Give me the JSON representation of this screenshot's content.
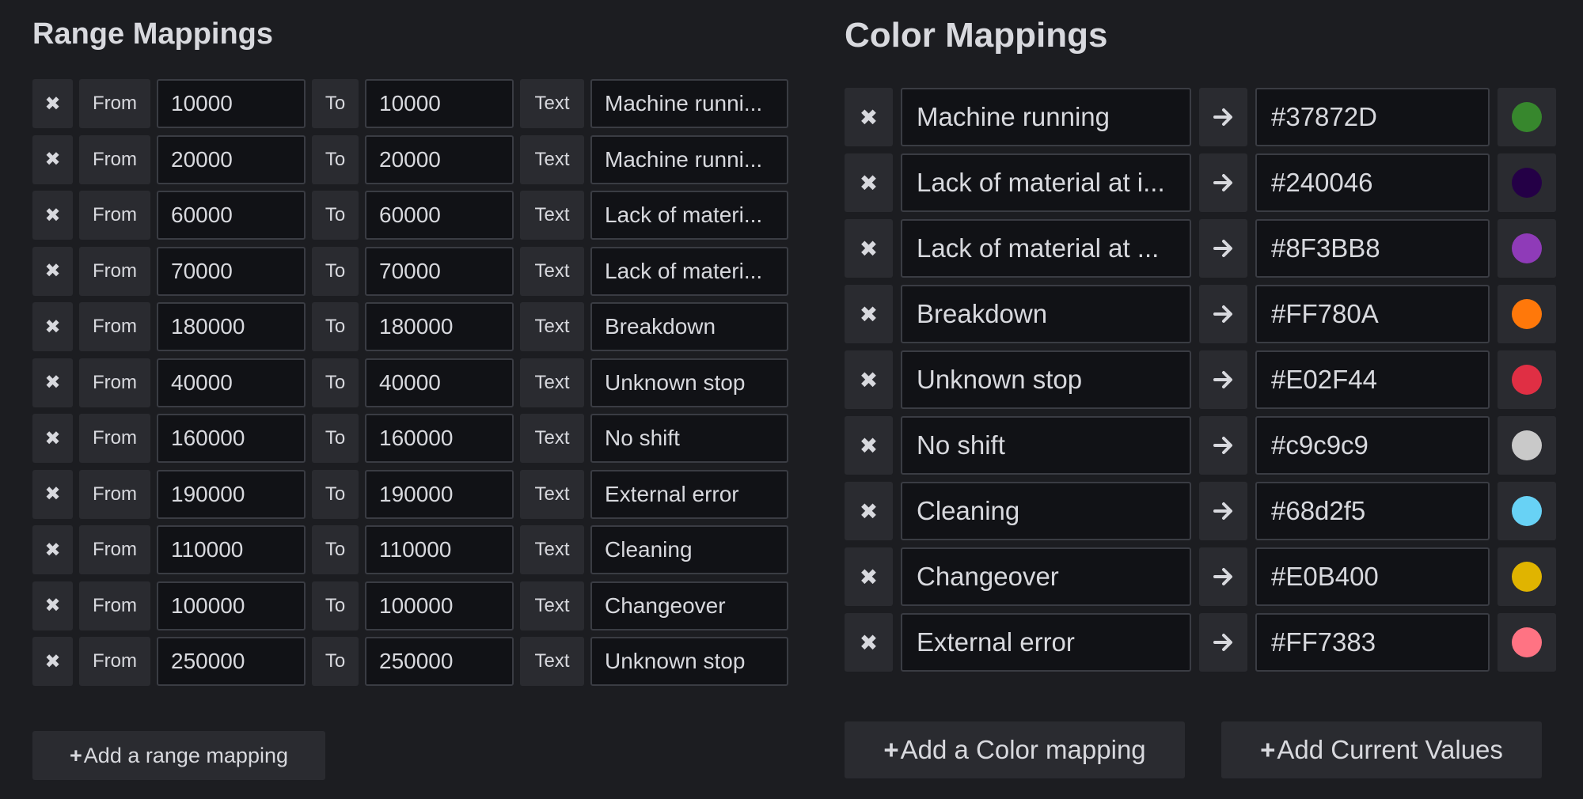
{
  "range_mappings": {
    "title": "Range Mappings",
    "from_label": "From",
    "to_label": "To",
    "text_label": "Text",
    "remove_glyph": "✖",
    "rows": [
      {
        "from": "10000",
        "to": "10000",
        "text": "Machine runni..."
      },
      {
        "from": "20000",
        "to": "20000",
        "text": "Machine runni..."
      },
      {
        "from": "60000",
        "to": "60000",
        "text": "Lack of materi..."
      },
      {
        "from": "70000",
        "to": "70000",
        "text": "Lack of materi..."
      },
      {
        "from": "180000",
        "to": "180000",
        "text": "Breakdown"
      },
      {
        "from": "40000",
        "to": "40000",
        "text": "Unknown stop"
      },
      {
        "from": "160000",
        "to": "160000",
        "text": "No shift"
      },
      {
        "from": "190000",
        "to": "190000",
        "text": "External error"
      },
      {
        "from": "110000",
        "to": "110000",
        "text": "Cleaning"
      },
      {
        "from": "100000",
        "to": "100000",
        "text": "Changeover"
      },
      {
        "from": "250000",
        "to": "250000",
        "text": "Unknown stop"
      }
    ],
    "add_plus": "+",
    "add_label": "Add a range mapping"
  },
  "color_mappings": {
    "title": "Color Mappings",
    "remove_glyph": "✖",
    "rows": [
      {
        "name": "Machine running",
        "hex": "#37872D"
      },
      {
        "name": "Lack of material at i...",
        "hex": "#240046"
      },
      {
        "name": "Lack of material at ...",
        "hex": "#8F3BB8"
      },
      {
        "name": "Breakdown",
        "hex": "#FF780A"
      },
      {
        "name": "Unknown stop",
        "hex": "#E02F44"
      },
      {
        "name": "No shift",
        "hex": "#c9c9c9"
      },
      {
        "name": "Cleaning",
        "hex": "#68d2f5"
      },
      {
        "name": "Changeover",
        "hex": "#E0B400"
      },
      {
        "name": "External error",
        "hex": "#FF7383"
      }
    ],
    "add_plus": "+",
    "add_color_label": "Add a Color mapping",
    "add_current_label": "Add Current Values"
  },
  "icons": {
    "remove": "close-icon",
    "arrow": "arrow-right-icon",
    "plus": "plus-icon"
  }
}
